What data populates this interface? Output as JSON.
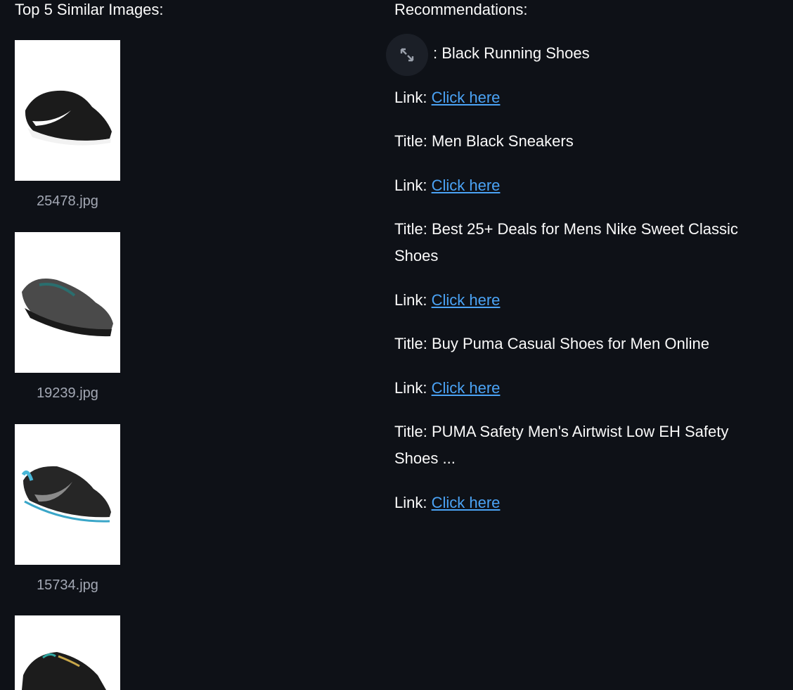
{
  "left": {
    "heading": "Top 5 Similar Images:",
    "images": [
      {
        "caption": "25478.jpg",
        "icon": "sneaker-white-swoosh"
      },
      {
        "caption": "19239.jpg",
        "icon": "sneaker-grey"
      },
      {
        "caption": "15734.jpg",
        "icon": "sneaker-blue-sole"
      },
      {
        "caption": "",
        "icon": "sneaker-black-partial"
      }
    ]
  },
  "right": {
    "heading": "Recommendations:",
    "first_title_visible": ": Black Running Shoes",
    "link_prefix": "Link:",
    "link_text": "Click here",
    "items": [
      {
        "title": "Title: Men Black Sneakers"
      },
      {
        "title": "Title: Best 25+ Deals for Mens Nike Sweet Classic Shoes"
      },
      {
        "title": "Title: Buy Puma Casual Shoes for Men Online"
      },
      {
        "title": "Title: PUMA Safety Men's Airtwist Low EH Safety Shoes ..."
      }
    ]
  },
  "colors": {
    "background": "#0e1117",
    "text": "#fafafa",
    "link": "#4ba3f5",
    "caption": "#a3a8b4"
  }
}
